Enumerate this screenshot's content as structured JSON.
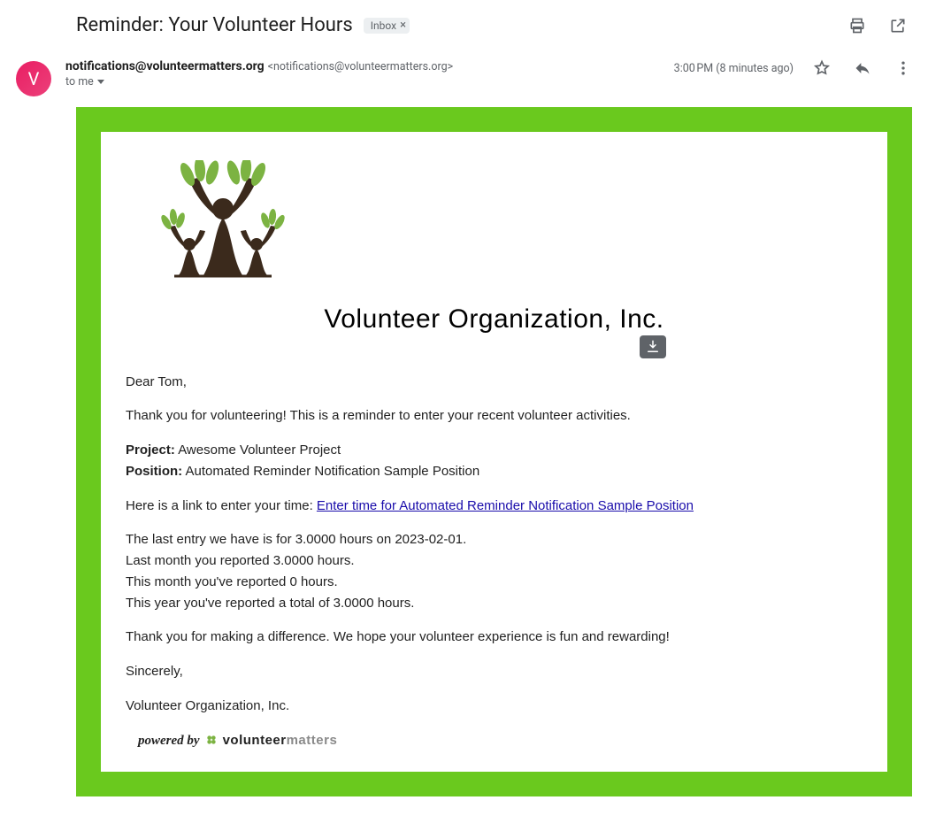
{
  "subject": {
    "text": "Reminder: Your Volunteer Hours",
    "chip_label": "Inbox"
  },
  "header": {
    "avatar_letter": "V",
    "sender_name": "notifications@volunteermatters.org",
    "sender_email": "<notifications@volunteermatters.org>",
    "to_text": "to me",
    "timestamp": "3:00 PM (8 minutes ago)"
  },
  "body": {
    "org_title": "Volunteer Organization, Inc.",
    "greeting": "Dear Tom,",
    "intro": "Thank you for volunteering! This is a reminder to enter your recent volunteer activities.",
    "project_label": "Project:",
    "project_value": " Awesome Volunteer Project",
    "position_label": "Position:",
    "position_value": " Automated Reminder Notification Sample Position",
    "link_prefix": "Here is a link to enter your time: ",
    "link_text": "Enter time for Automated Reminder Notification Sample Position",
    "last_entry": "The last entry we have is for 3.0000 hours on 2023-02-01.",
    "last_month": "Last month you reported 3.0000 hours.",
    "this_month": "This month you've reported 0 hours.",
    "this_year": "This year you've reported a total of 3.0000 hours.",
    "thanks": "Thank you for making a difference. We hope your volunteer experience is fun and rewarding!",
    "signoff": "Sincerely,",
    "org_signature": "Volunteer Organization, Inc.",
    "powered_by_label": "powered by",
    "brand_strong": "volunteer",
    "brand_light": "matters"
  }
}
